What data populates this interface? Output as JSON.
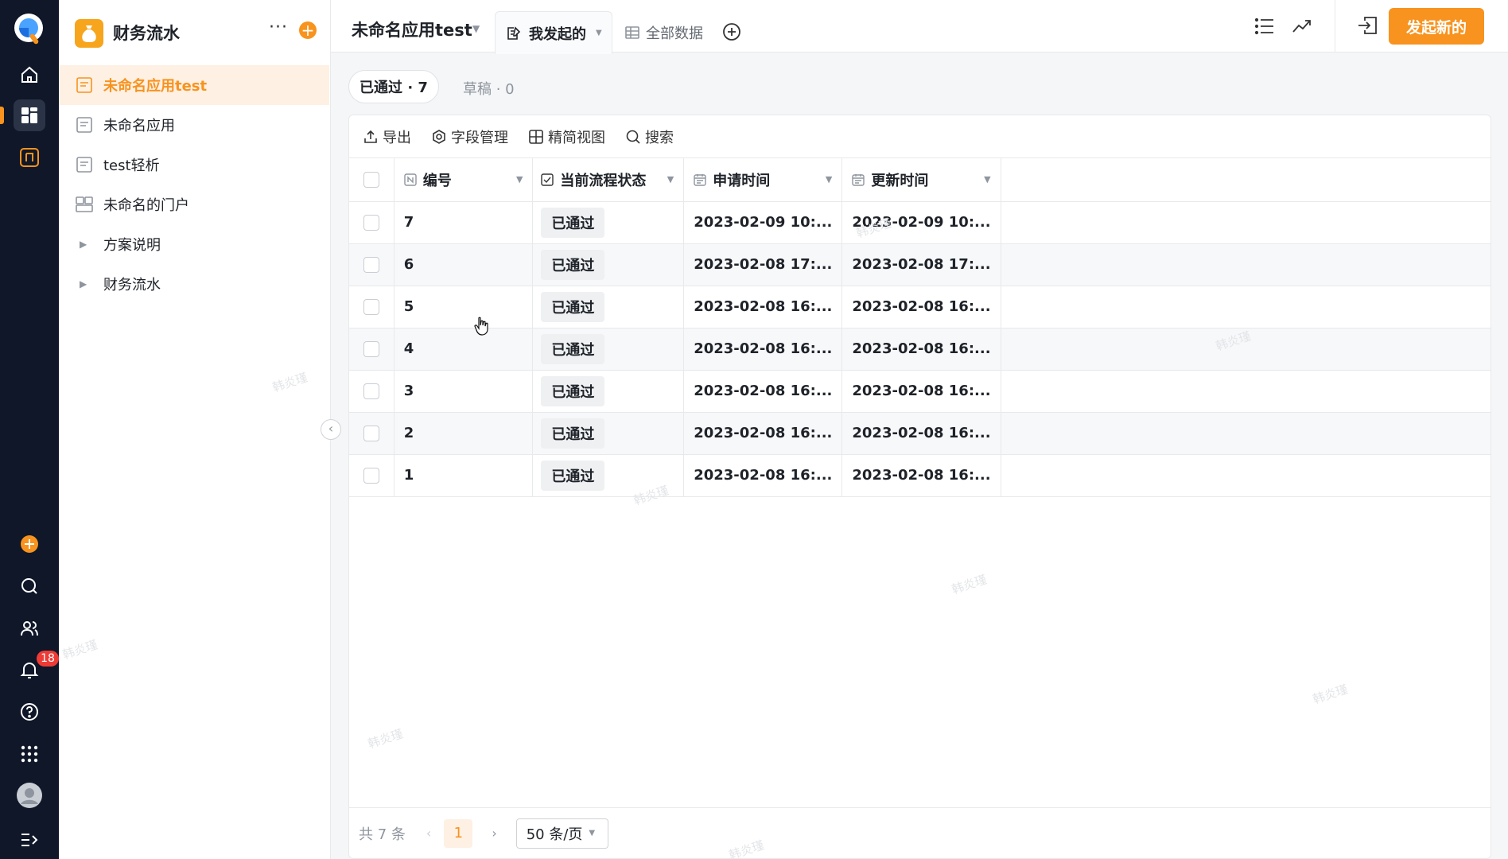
{
  "rail": {
    "notification_count": "18",
    "accent": "#f7931e",
    "background": "#0f1729"
  },
  "sidebar": {
    "title": "财务流水",
    "more": "···",
    "add": "+",
    "items": [
      {
        "label": "未命名应用test",
        "active": true
      },
      {
        "label": "未命名应用"
      },
      {
        "label": "test轻析"
      },
      {
        "label": "未命名的门户"
      },
      {
        "label": "方案说明"
      },
      {
        "label": "财务流水"
      }
    ]
  },
  "topbar": {
    "app_name": "未命名应用test",
    "tab_active": "我发起的",
    "tab_all": "全部数据",
    "primary_button": "发起新的"
  },
  "status_tabs": {
    "approved": "已通过 · 7",
    "draft": "草稿 · 0"
  },
  "toolbar": {
    "export": "导出",
    "fields": "字段管理",
    "compact": "精简视图",
    "search": "搜索"
  },
  "table": {
    "columns": [
      "编号",
      "当前流程状态",
      "申请时间",
      "更新时间"
    ],
    "rows": [
      {
        "id": "7",
        "status": "已通过",
        "apply": "2023-02-09 10:...",
        "update": "2023-02-09 10:..."
      },
      {
        "id": "6",
        "status": "已通过",
        "apply": "2023-02-08 17:...",
        "update": "2023-02-08 17:..."
      },
      {
        "id": "5",
        "status": "已通过",
        "apply": "2023-02-08 16:...",
        "update": "2023-02-08 16:..."
      },
      {
        "id": "4",
        "status": "已通过",
        "apply": "2023-02-08 16:...",
        "update": "2023-02-08 16:..."
      },
      {
        "id": "3",
        "status": "已通过",
        "apply": "2023-02-08 16:...",
        "update": "2023-02-08 16:..."
      },
      {
        "id": "2",
        "status": "已通过",
        "apply": "2023-02-08 16:...",
        "update": "2023-02-08 16:..."
      },
      {
        "id": "1",
        "status": "已通过",
        "apply": "2023-02-08 16:...",
        "update": "2023-02-08 16:..."
      }
    ]
  },
  "footer": {
    "total": "共 7 条",
    "page": "1",
    "page_size": "50 条/页"
  },
  "watermark": "韩炎瑾"
}
